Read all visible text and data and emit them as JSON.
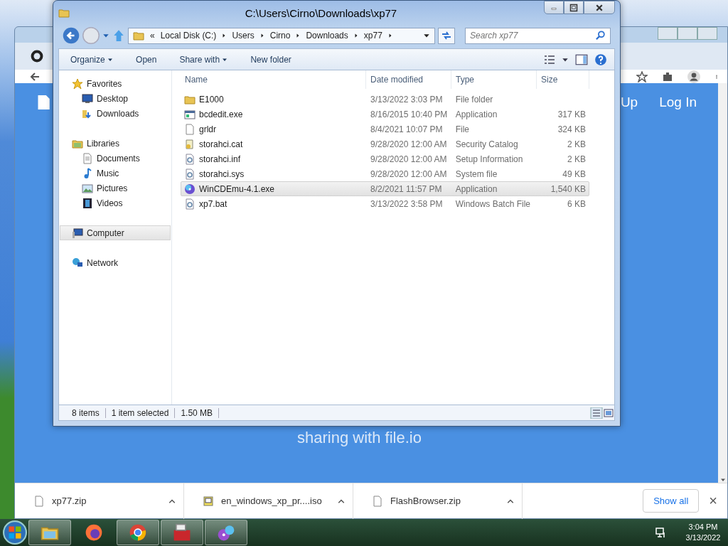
{
  "explorer": {
    "title": "C:\\Users\\Cirno\\Downloads\\xp77",
    "breadcrumb": [
      "«",
      "Local Disk (C:)",
      "Users",
      "Cirno",
      "Downloads",
      "xp77"
    ],
    "search": {
      "placeholder": "Search xp77"
    },
    "toolbar": [
      {
        "label": "Organize",
        "dropdown": true
      },
      {
        "label": "Open",
        "dropdown": false
      },
      {
        "label": "Share with",
        "dropdown": true
      },
      {
        "label": "New folder",
        "dropdown": false
      }
    ],
    "nav": [
      {
        "label": "Favorites",
        "kind": "star",
        "selected": false,
        "children": [
          {
            "label": "Desktop",
            "kind": "desktop",
            "selected": false
          },
          {
            "label": "Downloads",
            "kind": "downloads",
            "selected": false
          }
        ]
      },
      {
        "label": "Libraries",
        "kind": "libraries",
        "selected": false,
        "children": [
          {
            "label": "Documents",
            "kind": "document",
            "selected": false
          },
          {
            "label": "Music",
            "kind": "music",
            "selected": false
          },
          {
            "label": "Pictures",
            "kind": "pictures",
            "selected": false
          },
          {
            "label": "Videos",
            "kind": "videos",
            "selected": false
          }
        ]
      },
      {
        "label": "Computer",
        "kind": "computer",
        "selected": true
      },
      {
        "label": "Network",
        "kind": "network",
        "selected": false
      }
    ],
    "columns": [
      "Name",
      "Date modified",
      "Type",
      "Size"
    ],
    "rows": [
      {
        "name": "E1000",
        "date": "3/13/2022 3:03 PM",
        "type": "File folder",
        "size": "",
        "kind": "folder",
        "selected": false
      },
      {
        "name": "bcdedit.exe",
        "date": "8/16/2015 10:40 PM",
        "type": "Application",
        "size": "317 KB",
        "kind": "app",
        "selected": false
      },
      {
        "name": "grldr",
        "date": "8/4/2021 10:07 PM",
        "type": "File",
        "size": "324 KB",
        "kind": "file",
        "selected": false
      },
      {
        "name": "storahci.cat",
        "date": "9/28/2020 12:00 AM",
        "type": "Security Catalog",
        "size": "2 KB",
        "kind": "catalog",
        "selected": false
      },
      {
        "name": "storahci.inf",
        "date": "9/28/2020 12:00 AM",
        "type": "Setup Information",
        "size": "2 KB",
        "kind": "settings",
        "selected": false
      },
      {
        "name": "storahci.sys",
        "date": "9/28/2020 12:00 AM",
        "type": "System file",
        "size": "49 KB",
        "kind": "settings",
        "selected": false
      },
      {
        "name": "WinCDEmu-4.1.exe",
        "date": "8/2/2021 11:57 PM",
        "type": "Application",
        "size": "1,540 KB",
        "kind": "disc",
        "selected": true
      },
      {
        "name": "xp7.bat",
        "date": "3/13/2022 3:58 PM",
        "type": "Windows Batch File",
        "size": "6 KB",
        "kind": "settings",
        "selected": false
      }
    ],
    "status": [
      "8 items",
      "1 item selected",
      "1.50 MB"
    ]
  },
  "browser": {
    "header_links": [
      "Up",
      "Log In"
    ],
    "page_text": "sharing with file.io",
    "downloads": [
      {
        "name": "xp77.zip",
        "kind": "file"
      },
      {
        "name": "en_windows_xp_pr....iso",
        "kind": "iso"
      },
      {
        "name": "FlashBrowser.zip",
        "kind": "file"
      }
    ],
    "show_all": "Show all",
    "close": "×"
  },
  "taskbar": {
    "apps": [
      {
        "kind": "explorer",
        "selected": true
      },
      {
        "kind": "firefox",
        "selected": false
      },
      {
        "kind": "chrome",
        "selected": true
      },
      {
        "kind": "toolbox",
        "selected": true
      },
      {
        "kind": "disc",
        "selected": true
      }
    ],
    "time": "3:04 PM",
    "date": "3/13/2022"
  }
}
